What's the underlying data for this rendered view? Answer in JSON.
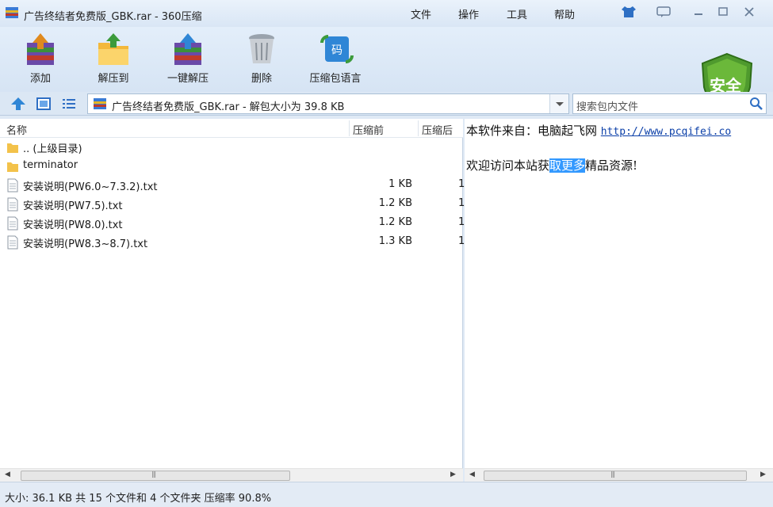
{
  "window": {
    "title": "广告终结者免费版_GBK.rar - 360压缩"
  },
  "menu": [
    "文件",
    "操作",
    "工具",
    "帮助"
  ],
  "toolbar": {
    "tools": [
      "添加",
      "解压到",
      "一键解压",
      "删除",
      "压缩包语言"
    ],
    "security_badge": "安全"
  },
  "navbar": {
    "path": "广告终结者免费版_GBK.rar - 解包大小为 39.8 KB",
    "search_placeholder": "搜索包内文件"
  },
  "file_list": {
    "columns": [
      "名称",
      "压缩前",
      "压缩后"
    ],
    "rows": [
      {
        "name": ".. (上级目录)",
        "size": "",
        "packed": "",
        "type": "folder"
      },
      {
        "name": "terminator",
        "size": "",
        "packed": "",
        "type": "folder"
      },
      {
        "name": "安装说明(PW6.0~7.3.2).txt",
        "size": "1 KB",
        "packed": "1",
        "type": "file"
      },
      {
        "name": "安装说明(PW7.5).txt",
        "size": "1.2 KB",
        "packed": "1",
        "type": "file"
      },
      {
        "name": "安装说明(PW8.0).txt",
        "size": "1.2 KB",
        "packed": "1",
        "type": "file"
      },
      {
        "name": "安装说明(PW8.3~8.7).txt",
        "size": "1.3 KB",
        "packed": "1",
        "type": "file"
      }
    ]
  },
  "comment": {
    "line1_prefix": "本软件来自：电脑起飞网 ",
    "line1_link": "http://www.pcqifei.co",
    "line2_before": "欢迎访问本站获",
    "line2_selected": "取更多",
    "line2_after": "精品资源!"
  },
  "status": {
    "text": "大小: 36.1 KB 共 15 个文件和 4 个文件夹 压缩率 90.8%"
  }
}
